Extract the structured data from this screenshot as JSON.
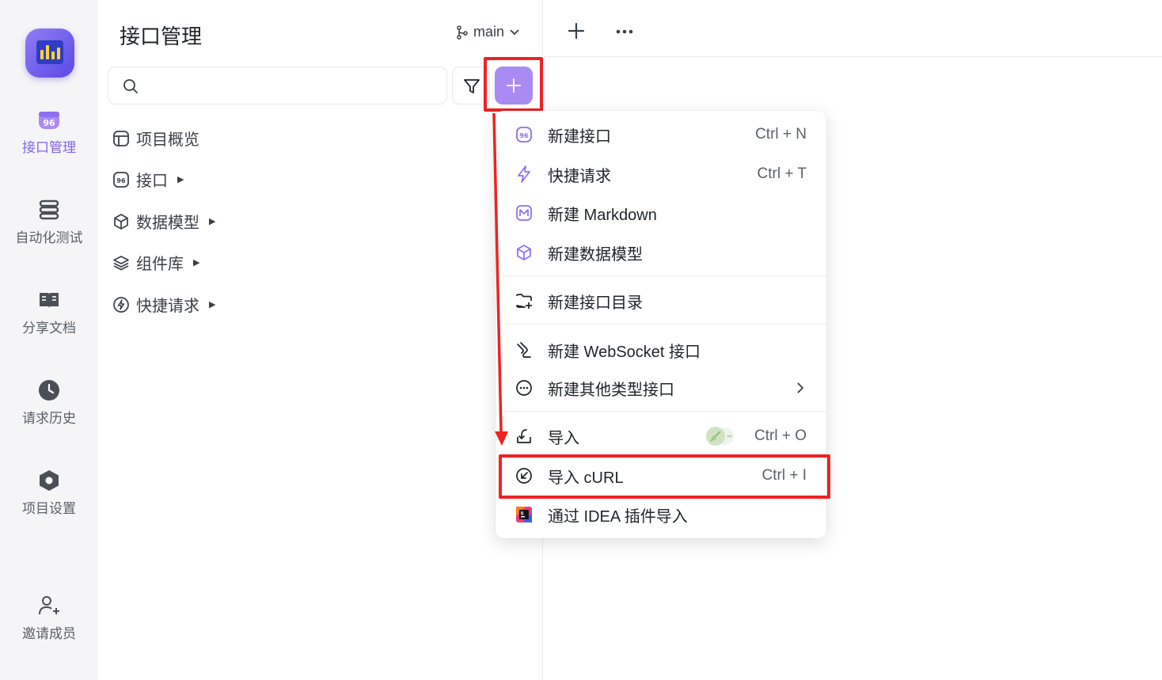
{
  "rail": {
    "items": [
      {
        "label": "接口管理",
        "icon": "api-icon"
      },
      {
        "label": "自动化测试",
        "icon": "automation-icon"
      },
      {
        "label": "分享文档",
        "icon": "book-icon"
      },
      {
        "label": "请求历史",
        "icon": "clock-icon"
      },
      {
        "label": "项目设置",
        "icon": "settings-hex-icon"
      },
      {
        "label": "邀请成员",
        "icon": "invite-user-icon"
      }
    ],
    "active_color": "#7e63ee"
  },
  "panel": {
    "title": "接口管理",
    "branch": "main",
    "search": {
      "placeholder": "",
      "value": ""
    },
    "tree": [
      {
        "label": "项目概览",
        "icon": "overview-icon",
        "has_children": false
      },
      {
        "label": "接口",
        "icon": "api-icon",
        "has_children": true
      },
      {
        "label": "数据模型",
        "icon": "cube-icon",
        "has_children": true
      },
      {
        "label": "组件库",
        "icon": "layers-icon",
        "has_children": true
      },
      {
        "label": "快捷请求",
        "icon": "bolt-circle-icon",
        "has_children": true
      }
    ]
  },
  "menu": {
    "items": [
      {
        "label": "新建接口",
        "shortcut": "Ctrl + N",
        "icon": "api-icon"
      },
      {
        "label": "快捷请求",
        "shortcut": "Ctrl + T",
        "icon": "bolt-icon"
      },
      {
        "label": "新建 Markdown",
        "shortcut": "",
        "icon": "markdown-icon"
      },
      {
        "label": "新建数据模型",
        "shortcut": "",
        "icon": "cube-icon"
      },
      {
        "label": "新建接口目录",
        "shortcut": "",
        "icon": "folder-add-icon"
      },
      {
        "label": "新建 WebSocket 接口",
        "shortcut": "",
        "icon": "websocket-icon"
      },
      {
        "label": "新建其他类型接口",
        "shortcut": "",
        "icon": "more-circle-icon"
      },
      {
        "label": "导入",
        "shortcut": "Ctrl + O",
        "icon": "import-icon"
      },
      {
        "label": "导入 cURL",
        "shortcut": "Ctrl + I",
        "icon": "curl-icon"
      },
      {
        "label": "通过 IDEA 插件导入",
        "shortcut": "",
        "icon": "idea-icon"
      }
    ]
  },
  "colors": {
    "accent": "#a98bf3",
    "highlight": "#ee2222"
  }
}
